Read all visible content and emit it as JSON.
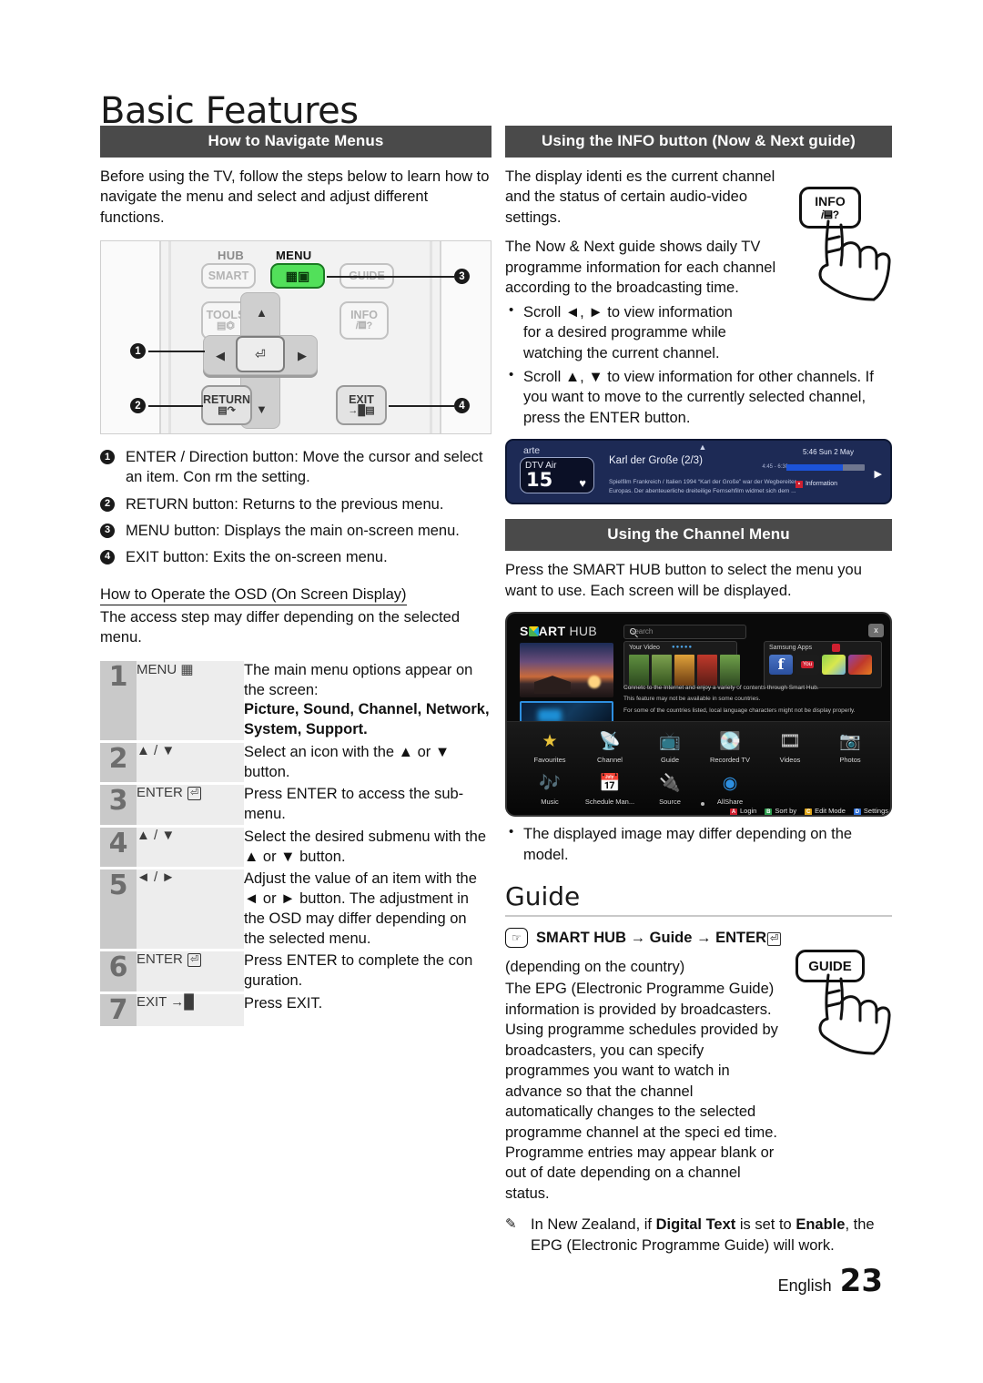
{
  "page": {
    "title": "Basic Features",
    "language": "English",
    "number": "23"
  },
  "left": {
    "section_title": "How to Navigate Menus",
    "intro": "Before using the TV, follow the steps below to learn how to navigate the menu and select and adjust different functions.",
    "remote": {
      "label_hub": "HUB",
      "label_menu": "MENU",
      "btn_smart": "SMART",
      "btn_guide": "GUIDE",
      "btn_tools": "TOOLS",
      "btn_info": "INFO",
      "btn_return": "RETURN",
      "btn_exit": "EXIT",
      "callouts": [
        "1",
        "2",
        "3",
        "4"
      ]
    },
    "callout_list": [
      {
        "num": "1",
        "text": "ENTER  / Direction button: Move the cursor and select an item. Con rm the setting."
      },
      {
        "num": "2",
        "text": "RETURN button: Returns to the previous menu."
      },
      {
        "num": "3",
        "text": "MENU button: Displays the main on-screen menu."
      },
      {
        "num": "4",
        "text": "EXIT button: Exits the on-screen menu."
      }
    ],
    "osd_heading": "How to Operate the OSD (On Screen Display)",
    "osd_intro": "The access step may differ depending on the selected menu.",
    "steps": [
      {
        "num": "1",
        "key": "MENU",
        "key_icon": "menu-icon",
        "desc_pre": "The main menu options appear on the screen:",
        "desc_bold": "Picture, Sound, Channel, Network, System, Support."
      },
      {
        "num": "2",
        "key": "▲ / ▼",
        "key_icon": "",
        "desc_pre": "Select an icon with the ▲ or ▼ button.",
        "desc_bold": ""
      },
      {
        "num": "3",
        "key": "ENTER",
        "key_icon": "enter-icon",
        "desc_pre": "Press ENTER  to access the sub-menu.",
        "desc_bold": ""
      },
      {
        "num": "4",
        "key": "▲ / ▼",
        "key_icon": "",
        "desc_pre": "Select the desired submenu with the ▲ or ▼ button.",
        "desc_bold": ""
      },
      {
        "num": "5",
        "key": "◄ / ►",
        "key_icon": "",
        "desc_pre": "Adjust the value of an item with the ◄ or ► button. The adjustment in the OSD may differ depending on the selected menu.",
        "desc_bold": ""
      },
      {
        "num": "6",
        "key": "ENTER",
        "key_icon": "enter-icon",
        "desc_pre": "Press ENTER  to complete the con guration.",
        "desc_bold": ""
      },
      {
        "num": "7",
        "key": "EXIT",
        "key_icon": "exit-icon",
        "desc_pre": "Press EXIT.",
        "desc_bold": ""
      }
    ]
  },
  "right": {
    "info_section_title": "Using the INFO button (Now & Next guide)",
    "info_p1": "The display identi es the current channel and the status of certain audio-video settings.",
    "info_p2": "The Now & Next guide shows daily TV programme information for each channel according to the broadcasting time.",
    "info_bullets": [
      "Scroll ◄, ► to view information for a desired programme while watching the current channel.",
      "Scroll ▲, ▼ to view information for other channels. If you want to move to the currently selected channel, press the ENTER  button."
    ],
    "info_key": "INFO",
    "info_bar": {
      "channel_name": "arte",
      "source": "DTV Air",
      "number": "15",
      "programme": "Karl der Große (2/3)",
      "description": "Spielfilm Frankreich / Italien 1994 “Karl der Große” war der Wegbereiter Europas. Der abenteuerliche dreiteilige Fernsehfilm widmet sich dem ...",
      "clock": "5:46 Sun 2 May",
      "slot": "4:45 - 6:30",
      "info_label": "Information",
      "info_key_color": "#cf2030"
    },
    "channel_section_title": "Using the Channel Menu",
    "channel_intro": "Press the SMART HUB button to select the menu you want to use. Each screen will be displayed.",
    "smart_hub": {
      "logo": "SMART HUB",
      "search_placeholder": "Search",
      "close_label": "x",
      "panel_video_title": "Your Video",
      "panel_apps_title": "Samsung Apps",
      "notes": [
        "Connetc to the Internet and enjoy a variety of contents through Smart Hub.",
        "This feature may not be available in some countries.",
        "For some of the countries listed, local language characters might not be display properly."
      ],
      "icons_row1": [
        "Favourites",
        "Channel",
        "Guide",
        "Recorded TV",
        "Videos",
        "Photos"
      ],
      "icons_row2": [
        "Music",
        "Schedule Man...",
        "Source",
        "AllShare"
      ],
      "footer": [
        {
          "key": "A",
          "label": "Login",
          "color": "#cf2030"
        },
        {
          "key": "B",
          "label": "Sort by",
          "color": "#2e9e4f"
        },
        {
          "key": "C",
          "label": "Edit Mode",
          "color": "#e0a71a"
        },
        {
          "key": "D",
          "label": "Settings",
          "color": "#2e6fd6"
        }
      ]
    },
    "model_note": "The displayed image may differ depending on the model.",
    "guide_heading": "Guide",
    "guide_path": "SMART HUB → Guide → ENTER",
    "guide_country": "(depending on the country)",
    "guide_body": "The EPG (Electronic Programme Guide) information is provided by broadcasters. Using programme schedules provided by broadcasters, you can specify programmes you want to watch in advance so that the channel automatically changes to the selected programme channel at the speci ed time. Programme entries may appear blank or out of date depending on a channel status.",
    "guide_key": "GUIDE",
    "guide_note_pre": "In New Zealand, if ",
    "guide_note_b1": "Digital Text",
    "guide_note_mid": " is set to ",
    "guide_note_b2": "Enable",
    "guide_note_post": ", the EPG (Electronic Programme Guide) will work."
  }
}
